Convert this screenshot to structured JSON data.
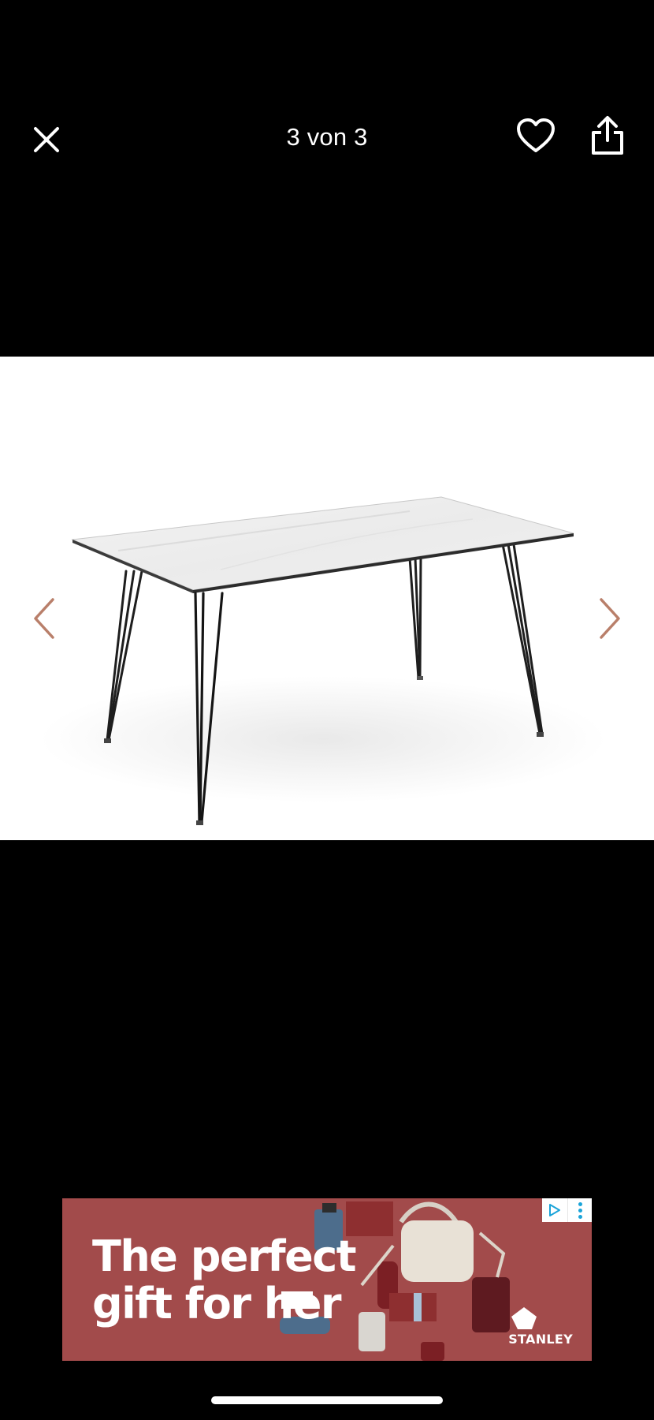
{
  "viewer": {
    "counter_text": "3 von 3"
  },
  "icons": {
    "close": "close-icon",
    "favorite": "heart-icon",
    "share": "share-icon",
    "previous": "chevron-left-icon",
    "next": "chevron-right-icon"
  },
  "colors": {
    "background": "#000000",
    "arrow": "#b97f6a",
    "ad_background": "#a24b4b"
  },
  "ad": {
    "headline_line1": "The perfect",
    "headline_line2": "gift for her",
    "brand": "STANLEY"
  }
}
